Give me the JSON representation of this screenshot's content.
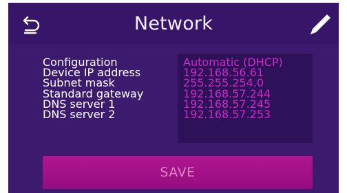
{
  "header": {
    "title": "Network",
    "back_icon": "back-arrow-icon",
    "edit_icon": "pencil-icon"
  },
  "settings": {
    "rows": [
      {
        "label": "Configuration",
        "value": "Automatic (DHCP)"
      },
      {
        "label": "Device IP address",
        "value": "192.168.56.61"
      },
      {
        "label": "Subnet mask",
        "value": "255.255.254.0"
      },
      {
        "label": "Standard gateway",
        "value": "192.168.57.244"
      },
      {
        "label": "DNS server 1",
        "value": "192.168.57.245"
      },
      {
        "label": "DNS server 2",
        "value": "192.168.57.253"
      }
    ]
  },
  "footer": {
    "save_label": "SAVE"
  },
  "colors": {
    "background": "#3c1a6e",
    "value_text": "#d226c8",
    "save_button": "#a6118a"
  }
}
